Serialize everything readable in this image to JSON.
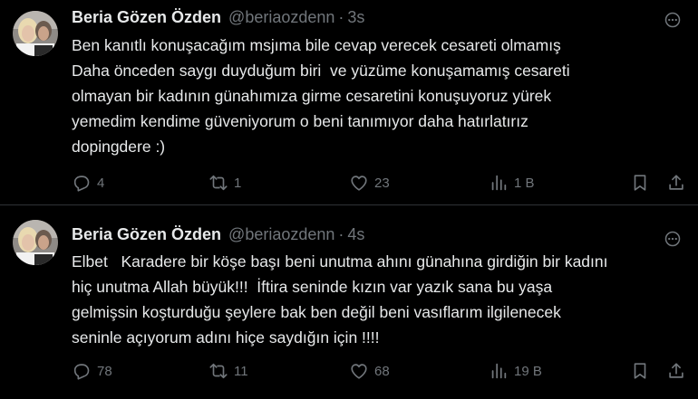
{
  "tweets": [
    {
      "author_name": "Beria Gözen Özden",
      "handle": "@beriaozdenn",
      "separator": "·",
      "timestamp": "3s",
      "text_lines": [
        "Ben kanıtlı konuşacağım msjıma bile cevap verecek cesareti olmamış",
        "Daha önceden saygı duyduğum biri  ve yüzüme konuşamamış cesareti",
        "olmayan bir kadının günahımıza girme cesaretini konuşuyoruz yürek",
        "yemedim kendime güveniyorum o beni tanımıyor daha hatırlatırız",
        "dopingdere :)"
      ],
      "replies": "4",
      "reposts": "1",
      "likes": "23",
      "views": "1 B"
    },
    {
      "author_name": "Beria Gözen Özden",
      "handle": "@beriaozdenn",
      "separator": "·",
      "timestamp": "4s",
      "text_lines": [
        "Elbet   Karadere bir köşe başı beni unutma ahını günahına girdiğin bir kadını",
        "hiç unutma Allah büyük!!!  İftira seninde kızın var yazık sana bu yaşa",
        "gelmişsin koşturduğu şeylere bak ben değil beni vasıflarım ilgilenecek",
        "seninle açıyorum adını hiçe saydığın için !!!!"
      ],
      "replies": "78",
      "reposts": "11",
      "likes": "68",
      "views": "19 B"
    }
  ],
  "icons": {
    "reply": "reply-icon",
    "repost": "repost-icon",
    "like": "heart-icon",
    "views": "views-icon",
    "bookmark": "bookmark-icon",
    "share": "share-icon",
    "more": "more-icon"
  },
  "colors": {
    "background": "#000000",
    "text": "#e7e9ea",
    "secondary": "#71767b",
    "divider": "#2f3336"
  }
}
